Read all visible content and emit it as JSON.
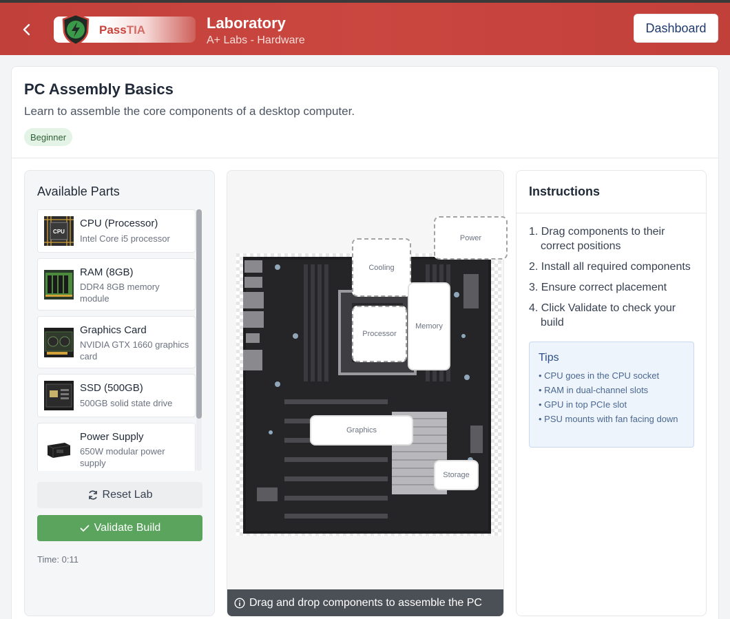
{
  "header": {
    "back_icon": "chevron-left-icon",
    "logo": {
      "part1": "Pass",
      "part2": "TIA",
      "icon": "lightning-shield-icon"
    },
    "title": "Laboratory",
    "subtitle": "A+ Labs - Hardware",
    "dashboard_label": "Dashboard"
  },
  "lab": {
    "title": "PC Assembly Basics",
    "description": "Learn to assemble the core components of a desktop computer.",
    "difficulty": "Beginner"
  },
  "parts_panel": {
    "title": "Available Parts",
    "parts": [
      {
        "name": "CPU (Processor)",
        "desc": "Intel Core i5 processor",
        "icon": "cpu-chip-icon",
        "chip_label": "CPU"
      },
      {
        "name": "RAM (8GB)",
        "desc": "DDR4 8GB memory module",
        "icon": "ram-module-icon"
      },
      {
        "name": "Graphics Card",
        "desc": "NVIDIA GTX 1660 graphics card",
        "icon": "graphics-card-icon"
      },
      {
        "name": "SSD (500GB)",
        "desc": "500GB solid state drive",
        "icon": "ssd-icon"
      },
      {
        "name": "Power Supply",
        "desc": "650W modular power supply",
        "icon": "power-supply-icon"
      }
    ],
    "reset_label": "Reset Lab",
    "validate_label": "Validate Build",
    "timer": "Time: 0:11"
  },
  "workspace": {
    "drop_zones": {
      "power": "Power",
      "cooling": "Cooling",
      "processor": "Processor",
      "memory": "Memory",
      "graphics": "Graphics",
      "storage": "Storage"
    },
    "hint": "Drag and drop components to assemble the PC"
  },
  "instructions": {
    "title": "Instructions",
    "steps": [
      "1. Drag components to their correct positions",
      "2. Install all required components",
      "3. Ensure correct placement",
      "4. Click Validate to check your build"
    ],
    "tips_title": "Tips",
    "tips": [
      "• CPU goes in the CPU socket",
      "• RAM in dual-channel slots",
      "• GPU in top PCIe slot",
      "• PSU mounts with fan facing down"
    ]
  },
  "colors": {
    "header": "#c2403a",
    "validate": "#5aa45d",
    "badge_bg": "#e3f3e5",
    "tips_bg": "#eef4fc"
  }
}
